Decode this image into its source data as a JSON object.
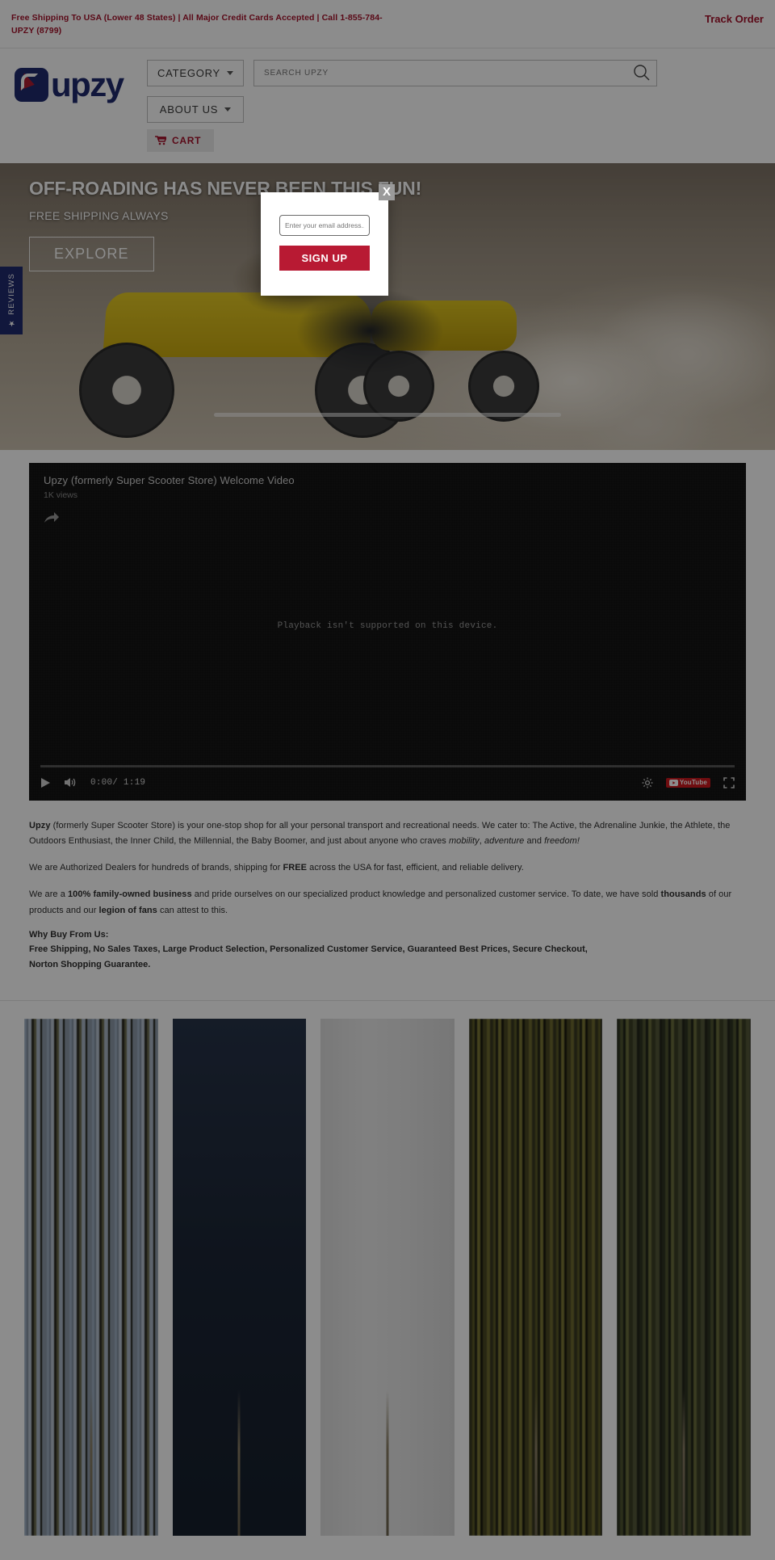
{
  "announcement": {
    "message": "Free Shipping To USA (Lower 48 States) | All Major Credit Cards Accepted | Call 1-855-784-UPZY (8799)",
    "track_order": "Track Order",
    "color": "#a4122a"
  },
  "header": {
    "logo_text": "upzy",
    "category_label": "CATEGORY",
    "about_label": "ABOUT US",
    "cart_label": "CART",
    "search": {
      "placeholder": "SEARCH UPZY",
      "value": ""
    }
  },
  "reviews_tab": {
    "label": "★ REVIEWS"
  },
  "hero": {
    "title": "OFF-ROADING HAS NEVER BEEN THIS FUN!",
    "subtitle": "FREE SHIPPING ALWAYS",
    "cta": "EXPLORE"
  },
  "video": {
    "title": "Upzy (formerly Super Scooter Store) Welcome Video",
    "views": "1K views",
    "message": "Playback isn't supported on this device.",
    "current_time": "0:00",
    "duration": "1:19",
    "time_display": "0:00/ 1:19",
    "youtube_label": "YouTube"
  },
  "copy": {
    "p1_brand": "Upzy",
    "p1_a": " (formerly Super Scooter Store) is your one-stop shop for all your personal transport and recreational needs.  We cater to:  The Active, the Adrenaline Junkie, the Athlete, the Outdoors Enthusiast, the Inner Child, the Millennial, the Baby Boomer, and just about anyone who craves ",
    "p1_i1": "mobility",
    "p1_b": ", ",
    "p1_i2": "adventure",
    "p1_c": " and ",
    "p1_i3": "freedom!",
    "p2_a": "We are Authorized Dealers for hundreds of brands, shipping for ",
    "p2_bold": "FREE",
    "p2_b": " across the USA for fast, efficient, and reliable delivery.",
    "p3_a": "We are a ",
    "p3_bold1": "100% family-owned business",
    "p3_b": " and pride ourselves on our specialized product knowledge and personalized customer service.  To date, we have sold ",
    "p3_bold2": "thousands",
    "p3_c": " of our products and our ",
    "p3_bold3": "legion of fans",
    "p3_d": " can attest to this.",
    "why_heading": "Why Buy From Us:",
    "why_line1": "Free Shipping, No Sales Taxes, Large Product Selection, Personalized Customer Service, Guaranteed Best Prices, Secure Checkout,",
    "why_line2": "Norton Shopping Guarantee."
  },
  "modal": {
    "close_label": "X",
    "email_placeholder": "Enter your email address...",
    "email_value": "",
    "signup_label": "SIGN UP",
    "accent": "#b81a33"
  },
  "products": [
    {
      "name": "product-1"
    },
    {
      "name": "product-2"
    },
    {
      "name": "product-3"
    },
    {
      "name": "product-4"
    },
    {
      "name": "product-5"
    }
  ]
}
